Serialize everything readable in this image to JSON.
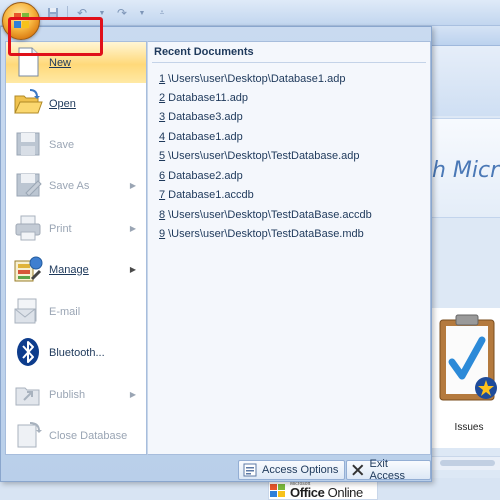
{
  "quick_access": {
    "save_icon": "save-icon",
    "undo_icon": "undo-icon",
    "redo_icon": "redo-icon",
    "customize_icon": "customize-icon"
  },
  "menu": {
    "items": [
      {
        "label": "New",
        "icon": "new-document-icon",
        "disabled": false,
        "submenu": false
      },
      {
        "label": "Open",
        "icon": "folder-open-icon",
        "disabled": false,
        "submenu": false
      },
      {
        "label": "Save",
        "icon": "save-icon",
        "disabled": true,
        "submenu": false
      },
      {
        "label": "Save As",
        "icon": "save-as-icon",
        "disabled": true,
        "submenu": true
      },
      {
        "label": "Print",
        "icon": "printer-icon",
        "disabled": true,
        "submenu": true
      },
      {
        "label": "Manage",
        "icon": "manage-icon",
        "disabled": false,
        "submenu": true
      },
      {
        "label": "E-mail",
        "icon": "email-icon",
        "disabled": true,
        "submenu": false
      },
      {
        "label": "Bluetooth...",
        "icon": "bluetooth-icon",
        "disabled": false,
        "submenu": false
      },
      {
        "label": "Publish",
        "icon": "publish-icon",
        "disabled": true,
        "submenu": true
      },
      {
        "label": "Close Database",
        "icon": "close-database-icon",
        "disabled": true,
        "submenu": false
      }
    ],
    "selected_item": "New"
  },
  "recent": {
    "title": "Recent Documents",
    "items": [
      {
        "num": "1",
        "path": "\\Users\\user\\Desktop\\Database1.adp"
      },
      {
        "num": "2",
        "path": "Database11.adp"
      },
      {
        "num": "3",
        "path": "Database3.adp"
      },
      {
        "num": "4",
        "path": "Database1.adp"
      },
      {
        "num": "5",
        "path": "\\Users\\user\\Desktop\\TestDatabase.adp"
      },
      {
        "num": "6",
        "path": "Database2.adp"
      },
      {
        "num": "7",
        "path": "Database1.accdb"
      },
      {
        "num": "8",
        "path": "\\Users\\user\\Desktop\\TestDataBase.accdb"
      },
      {
        "num": "9",
        "path": "\\Users\\user\\Desktop\\TestDataBase.mdb"
      }
    ]
  },
  "footer": {
    "options_label": "Access Options",
    "exit_label": "Exit Access"
  },
  "background": {
    "banner_text": "h Micro",
    "issues_label": "Issues",
    "office_online_small": "Microsoft",
    "office_online_a": "Office",
    "office_online_b": " Online"
  },
  "colors": {
    "highlight_box": "#e0101a",
    "selected_item_bg": "#ffd97a",
    "menu_text": "#1e395b",
    "disabled_text": "#9aa5b4"
  }
}
